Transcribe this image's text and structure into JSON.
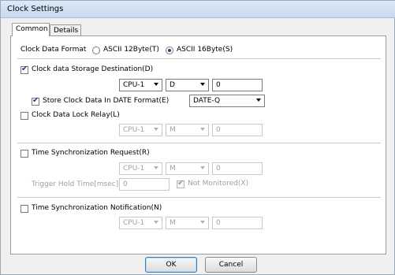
{
  "window": {
    "title": "Clock Settings"
  },
  "tabs": [
    {
      "label": "Common",
      "active": true
    },
    {
      "label": "Details",
      "active": false
    }
  ],
  "clock_data_format": {
    "label": "Clock Data Format",
    "options": [
      {
        "label": "ASCII 12Byte(T)",
        "selected": false
      },
      {
        "label": "ASCII 16Byte(S)",
        "selected": true
      }
    ]
  },
  "storage": {
    "label": "Clock data Storage Destination(D)",
    "checked": true,
    "cpu": "CPU-1",
    "device": "D",
    "address": "0",
    "date_format_label": "Store Clock Data In DATE Format(E)",
    "date_format_checked": true,
    "date_format_value": "DATE-Q"
  },
  "lock_relay": {
    "label": "Clock Data Lock Relay(L)",
    "checked": false,
    "cpu": "CPU-1",
    "device": "M",
    "address": "0"
  },
  "sync_request": {
    "label": "Time Synchronization Request(R)",
    "checked": false,
    "cpu": "CPU-1",
    "device": "M",
    "address": "0",
    "trigger_label": "Trigger Hold Time[msec]",
    "trigger_value": "0",
    "not_monitored_label": "Not Monitored(X)",
    "not_monitored_checked": true
  },
  "sync_notification": {
    "label": "Time Synchronization Notification(N)",
    "checked": false,
    "cpu": "CPU-1",
    "device": "M",
    "address": "0"
  },
  "buttons": {
    "ok": "OK",
    "cancel": "Cancel"
  }
}
